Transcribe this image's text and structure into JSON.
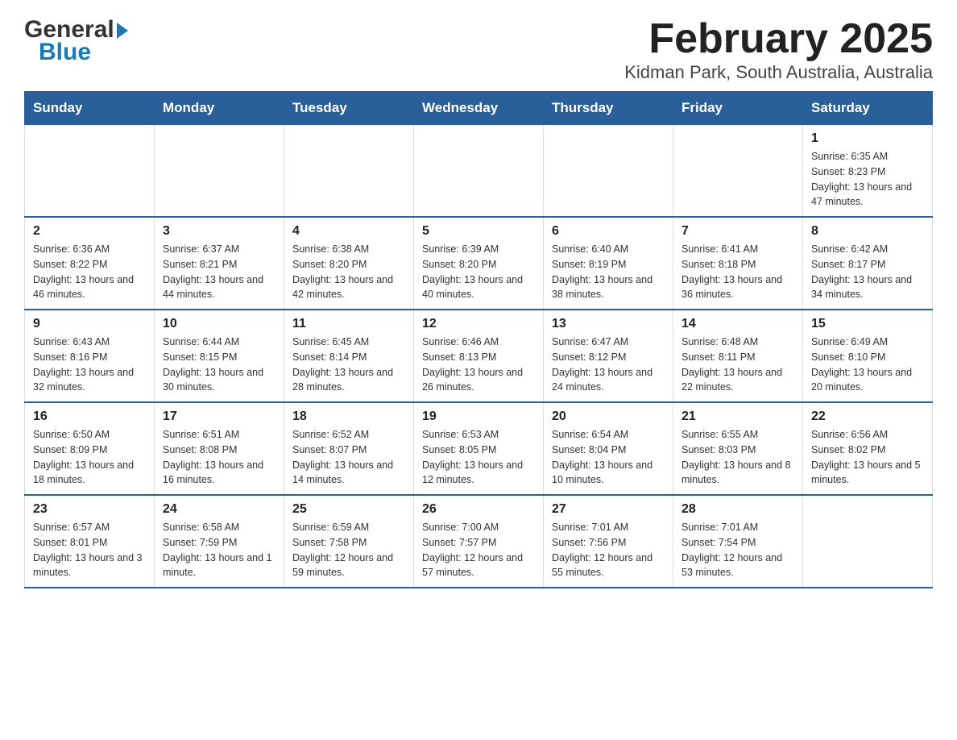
{
  "logo": {
    "general": "General",
    "blue": "Blue"
  },
  "title": "February 2025",
  "subtitle": "Kidman Park, South Australia, Australia",
  "weekdays": [
    "Sunday",
    "Monday",
    "Tuesday",
    "Wednesday",
    "Thursday",
    "Friday",
    "Saturday"
  ],
  "weeks": [
    [
      {
        "day": "",
        "info": ""
      },
      {
        "day": "",
        "info": ""
      },
      {
        "day": "",
        "info": ""
      },
      {
        "day": "",
        "info": ""
      },
      {
        "day": "",
        "info": ""
      },
      {
        "day": "",
        "info": ""
      },
      {
        "day": "1",
        "info": "Sunrise: 6:35 AM\nSunset: 8:23 PM\nDaylight: 13 hours and 47 minutes."
      }
    ],
    [
      {
        "day": "2",
        "info": "Sunrise: 6:36 AM\nSunset: 8:22 PM\nDaylight: 13 hours and 46 minutes."
      },
      {
        "day": "3",
        "info": "Sunrise: 6:37 AM\nSunset: 8:21 PM\nDaylight: 13 hours and 44 minutes."
      },
      {
        "day": "4",
        "info": "Sunrise: 6:38 AM\nSunset: 8:20 PM\nDaylight: 13 hours and 42 minutes."
      },
      {
        "day": "5",
        "info": "Sunrise: 6:39 AM\nSunset: 8:20 PM\nDaylight: 13 hours and 40 minutes."
      },
      {
        "day": "6",
        "info": "Sunrise: 6:40 AM\nSunset: 8:19 PM\nDaylight: 13 hours and 38 minutes."
      },
      {
        "day": "7",
        "info": "Sunrise: 6:41 AM\nSunset: 8:18 PM\nDaylight: 13 hours and 36 minutes."
      },
      {
        "day": "8",
        "info": "Sunrise: 6:42 AM\nSunset: 8:17 PM\nDaylight: 13 hours and 34 minutes."
      }
    ],
    [
      {
        "day": "9",
        "info": "Sunrise: 6:43 AM\nSunset: 8:16 PM\nDaylight: 13 hours and 32 minutes."
      },
      {
        "day": "10",
        "info": "Sunrise: 6:44 AM\nSunset: 8:15 PM\nDaylight: 13 hours and 30 minutes."
      },
      {
        "day": "11",
        "info": "Sunrise: 6:45 AM\nSunset: 8:14 PM\nDaylight: 13 hours and 28 minutes."
      },
      {
        "day": "12",
        "info": "Sunrise: 6:46 AM\nSunset: 8:13 PM\nDaylight: 13 hours and 26 minutes."
      },
      {
        "day": "13",
        "info": "Sunrise: 6:47 AM\nSunset: 8:12 PM\nDaylight: 13 hours and 24 minutes."
      },
      {
        "day": "14",
        "info": "Sunrise: 6:48 AM\nSunset: 8:11 PM\nDaylight: 13 hours and 22 minutes."
      },
      {
        "day": "15",
        "info": "Sunrise: 6:49 AM\nSunset: 8:10 PM\nDaylight: 13 hours and 20 minutes."
      }
    ],
    [
      {
        "day": "16",
        "info": "Sunrise: 6:50 AM\nSunset: 8:09 PM\nDaylight: 13 hours and 18 minutes."
      },
      {
        "day": "17",
        "info": "Sunrise: 6:51 AM\nSunset: 8:08 PM\nDaylight: 13 hours and 16 minutes."
      },
      {
        "day": "18",
        "info": "Sunrise: 6:52 AM\nSunset: 8:07 PM\nDaylight: 13 hours and 14 minutes."
      },
      {
        "day": "19",
        "info": "Sunrise: 6:53 AM\nSunset: 8:05 PM\nDaylight: 13 hours and 12 minutes."
      },
      {
        "day": "20",
        "info": "Sunrise: 6:54 AM\nSunset: 8:04 PM\nDaylight: 13 hours and 10 minutes."
      },
      {
        "day": "21",
        "info": "Sunrise: 6:55 AM\nSunset: 8:03 PM\nDaylight: 13 hours and 8 minutes."
      },
      {
        "day": "22",
        "info": "Sunrise: 6:56 AM\nSunset: 8:02 PM\nDaylight: 13 hours and 5 minutes."
      }
    ],
    [
      {
        "day": "23",
        "info": "Sunrise: 6:57 AM\nSunset: 8:01 PM\nDaylight: 13 hours and 3 minutes."
      },
      {
        "day": "24",
        "info": "Sunrise: 6:58 AM\nSunset: 7:59 PM\nDaylight: 13 hours and 1 minute."
      },
      {
        "day": "25",
        "info": "Sunrise: 6:59 AM\nSunset: 7:58 PM\nDaylight: 12 hours and 59 minutes."
      },
      {
        "day": "26",
        "info": "Sunrise: 7:00 AM\nSunset: 7:57 PM\nDaylight: 12 hours and 57 minutes."
      },
      {
        "day": "27",
        "info": "Sunrise: 7:01 AM\nSunset: 7:56 PM\nDaylight: 12 hours and 55 minutes."
      },
      {
        "day": "28",
        "info": "Sunrise: 7:01 AM\nSunset: 7:54 PM\nDaylight: 12 hours and 53 minutes."
      },
      {
        "day": "",
        "info": ""
      }
    ]
  ]
}
